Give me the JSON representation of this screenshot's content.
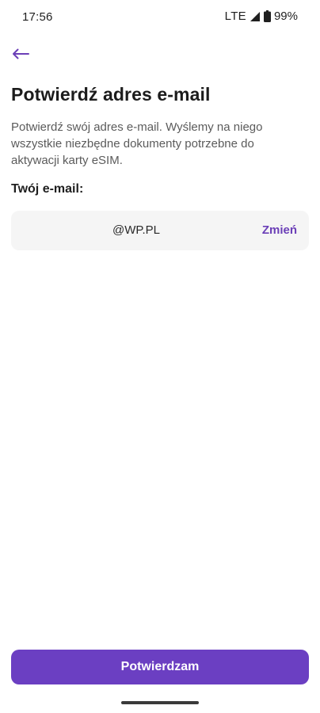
{
  "status_bar": {
    "time": "17:56",
    "network": "LTE",
    "battery": "99%",
    "icons": [
      "signal-icon",
      "battery-icon"
    ]
  },
  "header": {
    "back_icon": "arrow-left-icon",
    "title": "Potwierdź adres e-mail"
  },
  "main": {
    "description": "Potwierdź swój adres e-mail. Wyślemy na niego wszystkie niezbędne dokumenty potrzebne do aktywacji karty eSIM.",
    "email_label": "Twój e-mail:",
    "email_value": "@WP.PL",
    "change_label": "Zmień"
  },
  "footer": {
    "confirm_label": "Potwierdzam"
  },
  "colors": {
    "accent": "#6b3fc2",
    "link": "#6b3fb7",
    "card_background": "#f5f5f5"
  }
}
